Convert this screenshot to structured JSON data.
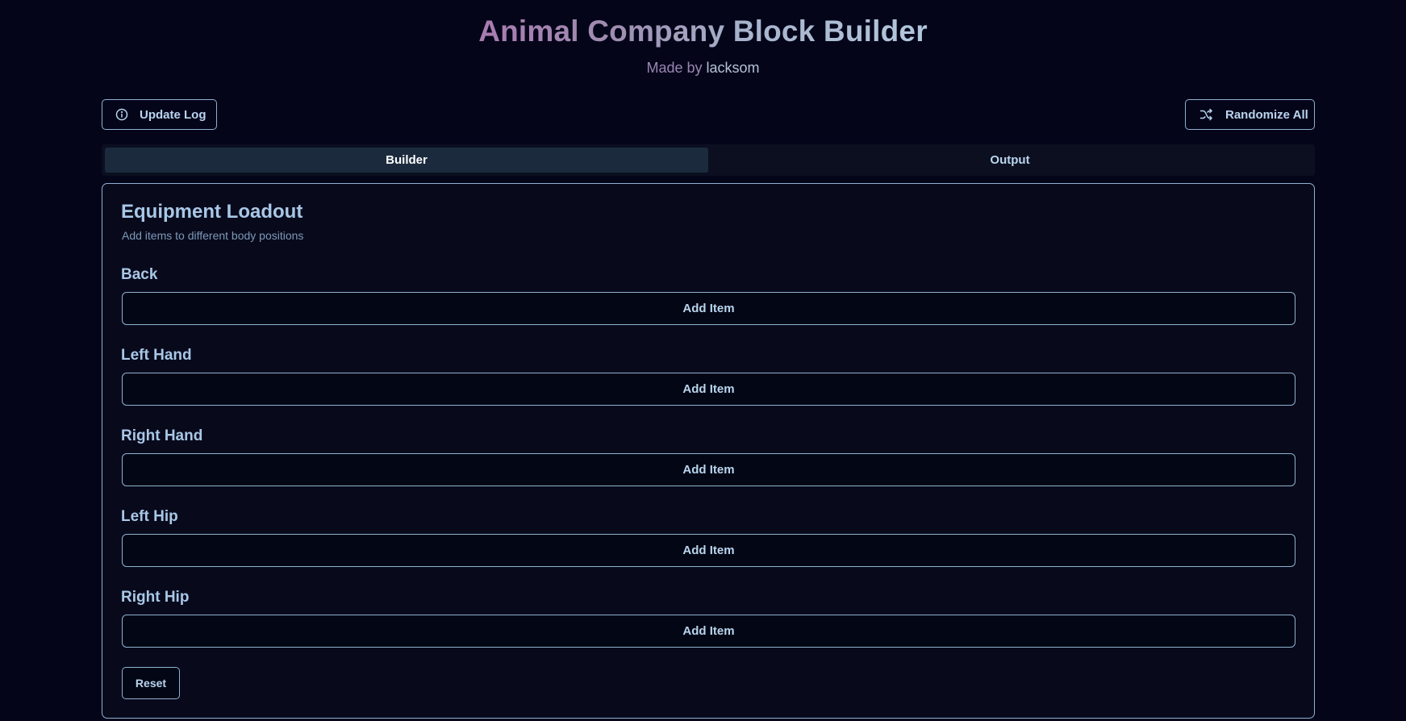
{
  "header": {
    "title": "Animal Company Block Builder",
    "subtitle_prefix": "Made by",
    "subtitle_author": "lacksom"
  },
  "toolbar": {
    "update_log_label": "Update Log",
    "update_log_icon": "info-circle-icon",
    "randomize_label": "Randomize All",
    "randomize_icon": "shuffle-icon"
  },
  "tabs": [
    {
      "label": "Builder",
      "active": true
    },
    {
      "label": "Output",
      "active": false
    }
  ],
  "loadout": {
    "title": "Equipment Loadout",
    "description": "Add items to different body positions",
    "slots": [
      {
        "label": "Back",
        "button": "Add Item"
      },
      {
        "label": "Left Hand",
        "button": "Add Item"
      },
      {
        "label": "Right Hand",
        "button": "Add Item"
      },
      {
        "label": "Left Hip",
        "button": "Add Item"
      },
      {
        "label": "Right Hip",
        "button": "Add Item"
      }
    ],
    "reset_label": "Reset"
  },
  "colors": {
    "background": "#05051a",
    "border": "#8fb1cf",
    "text": "#a9c7e6",
    "tab_active_bg": "#1b2b3d"
  }
}
